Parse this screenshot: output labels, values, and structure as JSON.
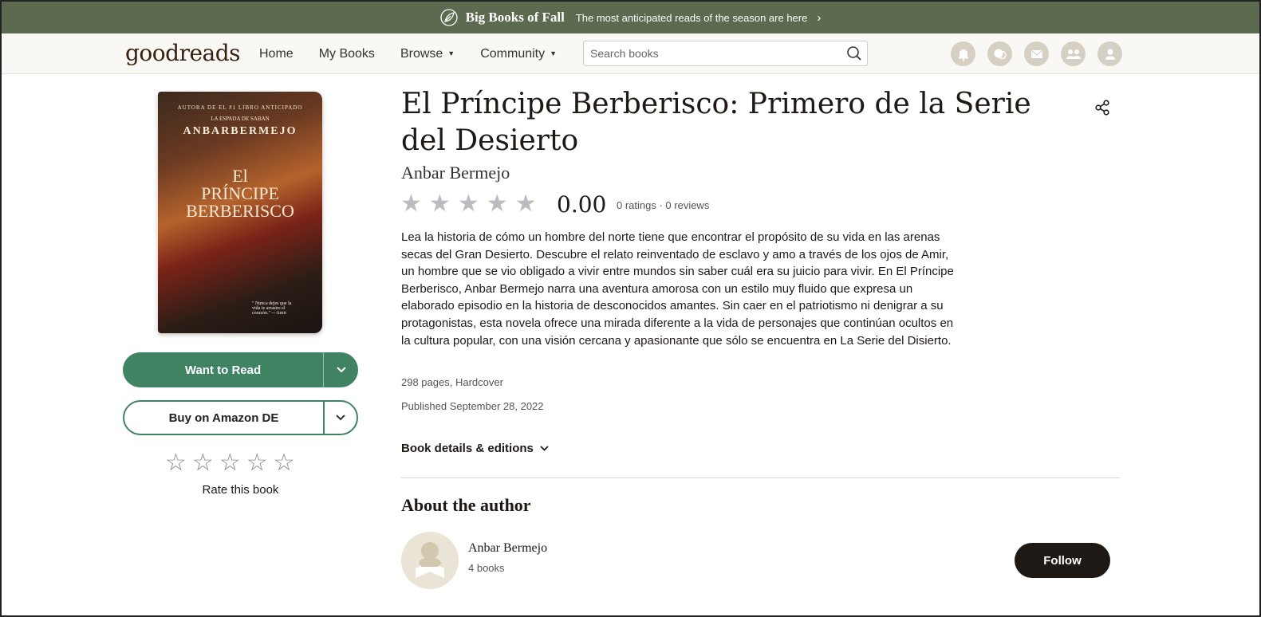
{
  "promo": {
    "title": "Big Books of Fall",
    "subtitle": "The most anticipated reads of the season are here"
  },
  "header": {
    "logo": "goodreads",
    "nav": {
      "home": "Home",
      "my_books": "My Books",
      "browse": "Browse",
      "community": "Community"
    },
    "search_placeholder": "Search books",
    "icons": [
      "notifications-icon",
      "discussions-icon",
      "messages-icon",
      "friends-icon",
      "profile-icon"
    ]
  },
  "book": {
    "cover": {
      "line1": "AUTORA DE EL #1 LIBRO ANTICIPADO",
      "line2": "LA ESPADA DE SABAN",
      "author_caps": "ANBARBERMEJO",
      "title_line1": "El",
      "title_line2": "PRÍNCIPE",
      "title_line3": "BERBERISCO",
      "quote": "\" Nunca dejes que la vida te arrastre el corazón.\" —Amir"
    },
    "title": "El Príncipe Berberisco: Primero de la Serie del Desierto",
    "author": "Anbar Bermejo",
    "rating": "0.00",
    "rating_stars": 0,
    "counts": "0 ratings · 0 reviews",
    "description": "Lea la historia de cómo un hombre del norte tiene que encontrar el propósito de su vida en las arenas secas del Gran Desierto. Descubre el relato reinventado de esclavo y amo a través de los ojos de Amir, un hombre que se vio obligado a vivir entre mundos sin saber cuál era su juicio para vivir. En El Príncipe Berberisco, Anbar Bermejo narra una aventura amorosa con un estilo muy fluido que expresa un elaborado episodio en la historia de desconocidos amantes. Sin caer en el patriotismo ni denigrar a su protagonistas, esta novela ofrece una mirada diferente a la vida de personajes que continúan ocultos en la cultura popular, con una visión cercana y apasionante que sólo se encuentra en La Serie del Disierto.",
    "pages_format": "298 pages, Hardcover",
    "published": "Published September 28, 2022",
    "details_link": "Book details & editions"
  },
  "actions": {
    "want_to_read": "Want to Read",
    "buy": "Buy on Amazon DE",
    "rate_label": "Rate this book"
  },
  "about": {
    "heading": "About the author",
    "name": "Anbar Bermejo",
    "books": "4 books",
    "follow": "Follow"
  },
  "colors": {
    "banner": "#5c6b4f",
    "primary_green": "#3f8363",
    "dark": "#1e1915",
    "star_empty": "#bbbcc2"
  }
}
